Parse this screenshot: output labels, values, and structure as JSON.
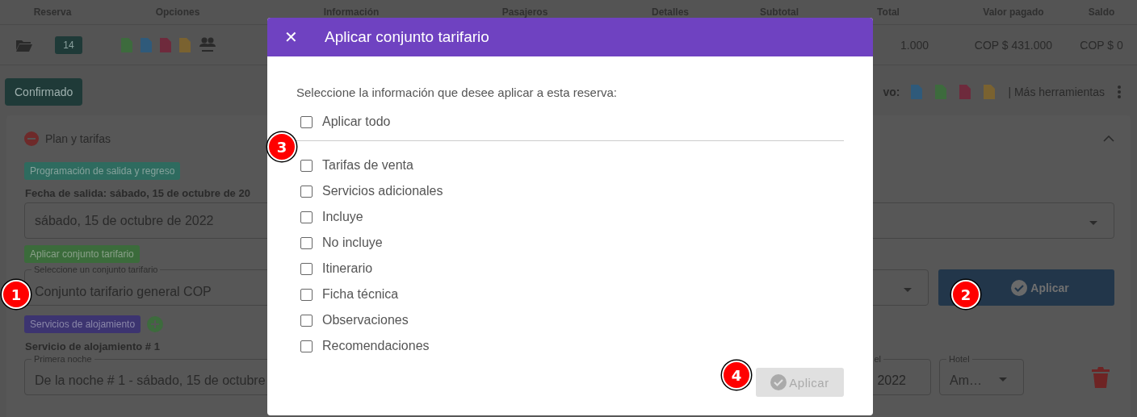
{
  "table": {
    "columns": [
      "Reserva",
      "Opciones",
      "Información",
      "Pasajeros",
      "Detalles",
      "Subtotal",
      "Total",
      "Valor pagado",
      "Saldo"
    ],
    "row": {
      "reserva": "14",
      "total": "1.000",
      "valor_pagado": "COP $ 431.000",
      "saldo": "COP $ 0"
    }
  },
  "toolbar": {
    "status": "Confirmado",
    "export_label": "vo:",
    "more_tools": "| Más herramientas"
  },
  "plan": {
    "title": "Plan y tarifas",
    "expanded": true,
    "schedule_badge": "Programación de salida y regreso",
    "departure_label": "Fecha de salida: sábado, 15 de octubre de 20",
    "departure_value": "sábado, 15 de octubre de 2022",
    "rate_badge": "Aplicar conjunto tarifario",
    "rate_select": {
      "label": "Seleccione un conjunto tarifario",
      "value": "Conjunto tarifario general COP"
    },
    "apply_button": "Aplicar",
    "lodging_badge": "Servicios de alojamiento",
    "lodging_title": "Servicio de alojamiento # 1",
    "first_night": {
      "label": "Primera noche",
      "value": "De la noche # 1 - sábado, 15 de octubre"
    },
    "last_night": {
      "label": "el",
      "value": "2022"
    },
    "hotel": {
      "label": "Hotel",
      "value": "Am…"
    }
  },
  "dialog": {
    "title": "Aplicar conjunto tarifario",
    "close": "✕",
    "prompt": "Seleccione la información que desee aplicar a esta reserva:",
    "apply_all": {
      "label": "Aplicar todo",
      "checked": false
    },
    "options": [
      {
        "label": "Tarifas de venta",
        "checked": false
      },
      {
        "label": "Servicios adicionales",
        "checked": false
      },
      {
        "label": "Incluye",
        "checked": false
      },
      {
        "label": "No incluye",
        "checked": false
      },
      {
        "label": "Itinerario",
        "checked": false
      },
      {
        "label": "Ficha técnica",
        "checked": false
      },
      {
        "label": "Observaciones",
        "checked": false
      },
      {
        "label": "Recomendaciones",
        "checked": false
      }
    ],
    "apply_button": {
      "label": "Aplicar",
      "disabled": true
    }
  },
  "markers": [
    "1",
    "2",
    "3",
    "4"
  ]
}
